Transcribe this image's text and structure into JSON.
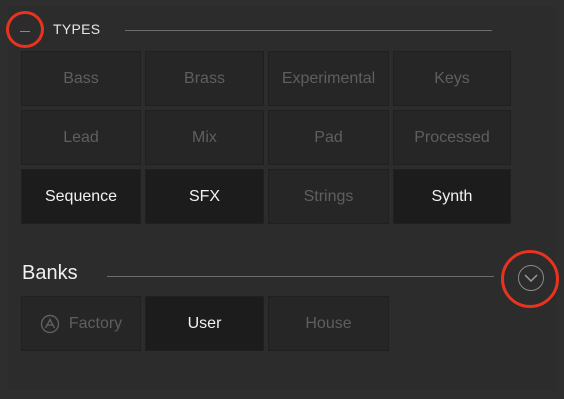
{
  "types": {
    "title": "TYPES",
    "items": [
      {
        "label": "Bass",
        "active": false
      },
      {
        "label": "Brass",
        "active": false
      },
      {
        "label": "Experimental",
        "active": false
      },
      {
        "label": "Keys",
        "active": false
      },
      {
        "label": "Lead",
        "active": false
      },
      {
        "label": "Mix",
        "active": false
      },
      {
        "label": "Pad",
        "active": false
      },
      {
        "label": "Processed",
        "active": false
      },
      {
        "label": "Sequence",
        "active": true
      },
      {
        "label": "SFX",
        "active": true
      },
      {
        "label": "Strings",
        "active": false
      },
      {
        "label": "Synth",
        "active": true
      }
    ]
  },
  "banks": {
    "title": "Banks",
    "items": [
      {
        "label": "Factory",
        "active": false,
        "icon": "arturia-logo-icon"
      },
      {
        "label": "User",
        "active": true
      },
      {
        "label": "House",
        "active": false
      }
    ]
  },
  "colors": {
    "highlight": "#e8331f",
    "active_text": "#f2f2f2",
    "inactive_text": "#5f5f5f",
    "background": "#2c2c2c"
  }
}
